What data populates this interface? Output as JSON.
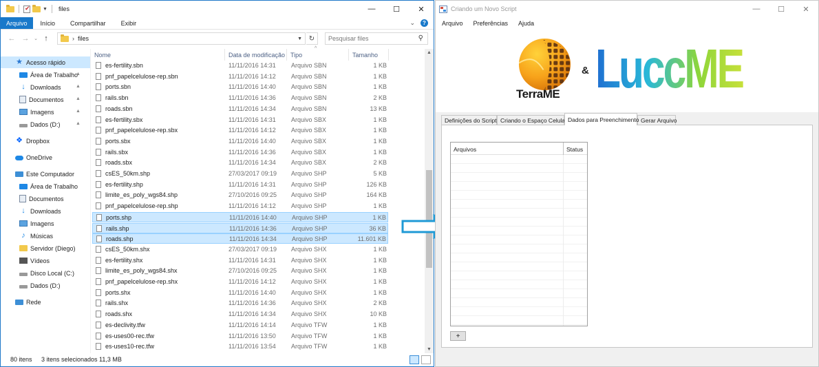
{
  "explorer": {
    "title": "files",
    "ribbon_tabs": [
      "Arquivo",
      "Início",
      "Compartilhar",
      "Exibir"
    ],
    "address": "files",
    "search_placeholder": "Pesquisar files",
    "columns": {
      "name": "Nome",
      "date": "Data de modificação",
      "type": "Tipo",
      "size": "Tamanho"
    },
    "nav": [
      {
        "label": "Acesso rápido",
        "icon": "star-icon",
        "pinned": false
      },
      {
        "label": "Área de Trabalho",
        "icon": "desktop-icon",
        "pinned": true
      },
      {
        "label": "Downloads",
        "icon": "download-icon",
        "pinned": true
      },
      {
        "label": "Documentos",
        "icon": "documents-icon",
        "pinned": true
      },
      {
        "label": "Imagens",
        "icon": "pictures-icon",
        "pinned": true
      },
      {
        "label": "Dados (D:)",
        "icon": "drive-icon",
        "pinned": true
      },
      {
        "label": "Dropbox",
        "icon": "dropbox-icon",
        "pinned": false
      },
      {
        "label": "OneDrive",
        "icon": "cloud-icon",
        "pinned": false
      },
      {
        "label": "Este Computador",
        "icon": "computer-icon",
        "pinned": false
      },
      {
        "label": "Área de Trabalho",
        "icon": "desktop-icon",
        "pinned": false
      },
      {
        "label": "Documentos",
        "icon": "documents-icon",
        "pinned": false
      },
      {
        "label": "Downloads",
        "icon": "download-icon",
        "pinned": false
      },
      {
        "label": "Imagens",
        "icon": "pictures-icon",
        "pinned": false
      },
      {
        "label": "Músicas",
        "icon": "music-icon",
        "pinned": false
      },
      {
        "label": "Servidor (Diego)",
        "icon": "folder-icon",
        "pinned": false
      },
      {
        "label": "Vídeos",
        "icon": "video-icon",
        "pinned": false
      },
      {
        "label": "Disco Local (C:)",
        "icon": "drive-icon",
        "pinned": false
      },
      {
        "label": "Dados (D:)",
        "icon": "drive-icon",
        "pinned": false
      },
      {
        "label": "Rede",
        "icon": "network-icon",
        "pinned": false
      }
    ],
    "files": [
      {
        "name": "es-fertility.sbn",
        "date": "11/11/2016 14:31",
        "type": "Arquivo SBN",
        "size": "1 KB",
        "selected": false
      },
      {
        "name": "pnf_papelcelulose-rep.sbn",
        "date": "11/11/2016 14:12",
        "type": "Arquivo SBN",
        "size": "1 KB",
        "selected": false
      },
      {
        "name": "ports.sbn",
        "date": "11/11/2016 14:40",
        "type": "Arquivo SBN",
        "size": "1 KB",
        "selected": false
      },
      {
        "name": "rails.sbn",
        "date": "11/11/2016 14:36",
        "type": "Arquivo SBN",
        "size": "2 KB",
        "selected": false
      },
      {
        "name": "roads.sbn",
        "date": "11/11/2016 14:34",
        "type": "Arquivo SBN",
        "size": "13 KB",
        "selected": false
      },
      {
        "name": "es-fertility.sbx",
        "date": "11/11/2016 14:31",
        "type": "Arquivo SBX",
        "size": "1 KB",
        "selected": false
      },
      {
        "name": "pnf_papelcelulose-rep.sbx",
        "date": "11/11/2016 14:12",
        "type": "Arquivo SBX",
        "size": "1 KB",
        "selected": false
      },
      {
        "name": "ports.sbx",
        "date": "11/11/2016 14:40",
        "type": "Arquivo SBX",
        "size": "1 KB",
        "selected": false
      },
      {
        "name": "rails.sbx",
        "date": "11/11/2016 14:36",
        "type": "Arquivo SBX",
        "size": "1 KB",
        "selected": false
      },
      {
        "name": "roads.sbx",
        "date": "11/11/2016 14:34",
        "type": "Arquivo SBX",
        "size": "2 KB",
        "selected": false
      },
      {
        "name": "csES_50km.shp",
        "date": "27/03/2017 09:19",
        "type": "Arquivo SHP",
        "size": "5 KB",
        "selected": false
      },
      {
        "name": "es-fertility.shp",
        "date": "11/11/2016 14:31",
        "type": "Arquivo SHP",
        "size": "126 KB",
        "selected": false
      },
      {
        "name": "limite_es_poly_wgs84.shp",
        "date": "27/10/2016 09:25",
        "type": "Arquivo SHP",
        "size": "164 KB",
        "selected": false
      },
      {
        "name": "pnf_papelcelulose-rep.shp",
        "date": "11/11/2016 14:12",
        "type": "Arquivo SHP",
        "size": "1 KB",
        "selected": false
      },
      {
        "name": "ports.shp",
        "date": "11/11/2016 14:40",
        "type": "Arquivo SHP",
        "size": "1 KB",
        "selected": true
      },
      {
        "name": "rails.shp",
        "date": "11/11/2016 14:36",
        "type": "Arquivo SHP",
        "size": "36 KB",
        "selected": true
      },
      {
        "name": "roads.shp",
        "date": "11/11/2016 14:34",
        "type": "Arquivo SHP",
        "size": "11.601 KB",
        "selected": true
      },
      {
        "name": "csES_50km.shx",
        "date": "27/03/2017 09:19",
        "type": "Arquivo SHX",
        "size": "1 KB",
        "selected": false
      },
      {
        "name": "es-fertility.shx",
        "date": "11/11/2016 14:31",
        "type": "Arquivo SHX",
        "size": "1 KB",
        "selected": false
      },
      {
        "name": "limite_es_poly_wgs84.shx",
        "date": "27/10/2016 09:25",
        "type": "Arquivo SHX",
        "size": "1 KB",
        "selected": false
      },
      {
        "name": "pnf_papelcelulose-rep.shx",
        "date": "11/11/2016 14:12",
        "type": "Arquivo SHX",
        "size": "1 KB",
        "selected": false
      },
      {
        "name": "ports.shx",
        "date": "11/11/2016 14:40",
        "type": "Arquivo SHX",
        "size": "1 KB",
        "selected": false
      },
      {
        "name": "rails.shx",
        "date": "11/11/2016 14:36",
        "type": "Arquivo SHX",
        "size": "2 KB",
        "selected": false
      },
      {
        "name": "roads.shx",
        "date": "11/11/2016 14:34",
        "type": "Arquivo SHX",
        "size": "10 KB",
        "selected": false
      },
      {
        "name": "es-declivity.tfw",
        "date": "11/11/2016 14:14",
        "type": "Arquivo TFW",
        "size": "1 KB",
        "selected": false
      },
      {
        "name": "es-uses00-rec.tfw",
        "date": "11/11/2016 13:50",
        "type": "Arquivo TFW",
        "size": "1 KB",
        "selected": false
      },
      {
        "name": "es-uses10-rec.tfw",
        "date": "11/11/2016 13:54",
        "type": "Arquivo TFW",
        "size": "1 KB",
        "selected": false
      }
    ],
    "status": {
      "items": "80 itens",
      "selected": "3 itens selecionados",
      "size": "11,3 MB"
    }
  },
  "script_window": {
    "title": "Criando um Novo Script",
    "menu": [
      "Arquivo",
      "Preferências",
      "Ajuda"
    ],
    "logo_terra": "TerraME",
    "logo_amp": "&",
    "logo_lucc": "LuccME",
    "tabs": [
      "Definições do Script",
      "Criando o Espaço Celular",
      "Dados para Preenchimento",
      "Gerar Arquivo"
    ],
    "active_tab": 2,
    "grid_headers": {
      "files": "Arquivos",
      "status": "Status"
    },
    "add_button": "+"
  },
  "colors": {
    "accent": "#1979ca",
    "selection": "#cce8ff",
    "arrow": "#1f9ad6",
    "lucc_gradient": [
      "#1f6fd1",
      "#29b8d8",
      "#8fd63a",
      "#c7e03a"
    ]
  }
}
